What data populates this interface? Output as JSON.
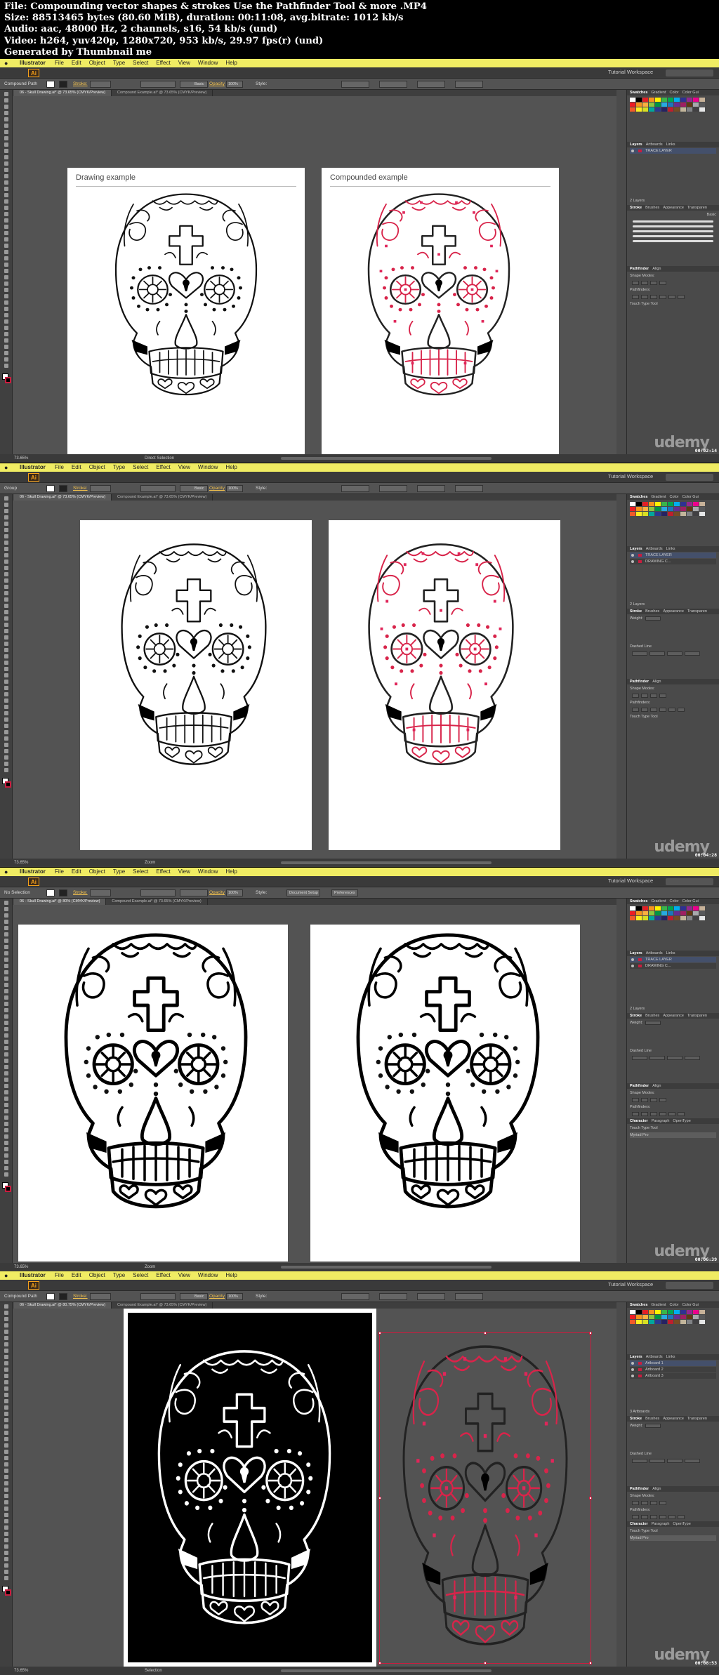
{
  "header": {
    "file_line": "File: Compounding vector shapes & strokes  Use the Pathfinder Tool & more .MP4",
    "size_line": "Size: 88513465 bytes (80.60 MiB), duration: 00:11:08, avg.bitrate: 1012 kb/s",
    "audio_line": "Audio: aac, 48000 Hz, 2 channels, s16, 54 kb/s (und)",
    "video_line": "Video: h264, yuv420p, 1280x720, 953 kb/s, 29.97 fps(r) (und)",
    "generated_line": "Generated by Thumbnail me"
  },
  "menubar": {
    "app_name": "Illustrator",
    "items": [
      "File",
      "Edit",
      "Object",
      "Type",
      "Select",
      "Effect",
      "View",
      "Window",
      "Help"
    ]
  },
  "appbar": {
    "logo": "Ai",
    "workspace": "Tutorial Workspace"
  },
  "panels": {
    "top_tabs": [
      "Swatches",
      "Gradient",
      "Color",
      "Color Gui"
    ],
    "layers_tabs": [
      "Layers",
      "Artboards",
      "Links"
    ],
    "stroke_tabs": [
      "Stroke",
      "Brushes",
      "Appearance",
      "Transparen"
    ],
    "stroke_weight_label": "Weight:",
    "dashed_line_label": "Dashed Line",
    "pathfinder_tabs": [
      "Pathfinder",
      "Align"
    ],
    "shape_modes_label": "Shape Modes:",
    "pathfinders_label": "Pathfinders:",
    "character_tabs": [
      "Character",
      "Paragraph",
      "OpenType"
    ],
    "touch_type_label": "Touch Type Tool",
    "font_name": "Myriad Pro",
    "brushes_basic": "Basic"
  },
  "watermark": "udemy",
  "frames": [
    {
      "selection_type": "Compound Path",
      "stroke_label": "Stroke:",
      "opacity_label": "Opacity",
      "style_label": "Style:",
      "brush_label": "Basic",
      "opacity_value": "100%",
      "tabs": [
        "06 - Skull Drawing.ai* @ 73.65% (CMYK/Preview)",
        "Compound Example.ai* @ 73.65% (CMYK/Preview)"
      ],
      "artboards": [
        "Drawing example",
        "Compounded example"
      ],
      "layers": [
        "TRACE LAYER"
      ],
      "layers_count": "2 Layers",
      "zoom": "73.65%",
      "status": "Direct Selection",
      "timestamp": "00:02:14"
    },
    {
      "selection_type": "Group",
      "stroke_label": "Stroke:",
      "opacity_label": "Opacity",
      "style_label": "Style:",
      "brush_label": "Basic",
      "opacity_value": "100%",
      "tabs": [
        "06 - Skull Drawing.ai* @ 73.65% (CMYK/Preview)",
        "Compound Example.ai* @ 73.65% (CMYK/Preview)"
      ],
      "artboards": [
        "",
        ""
      ],
      "layers": [
        "TRACE LAYER",
        "DRAWING C..."
      ],
      "layers_count": "2 Layers",
      "zoom": "73.65%",
      "status": "Zoom",
      "timestamp": "00:04:28"
    },
    {
      "selection_type": "No Selection",
      "stroke_label": "Stroke:",
      "opacity_label": "Opacity",
      "style_label": "Style:",
      "brush_label": "",
      "opacity_value": "100%",
      "document_setup": "Document Setup",
      "preferences": "Preferences",
      "tabs": [
        "06 - Skull Drawing.ai* @ 80% (CMYK/Preview)",
        "Compound Example.ai* @ 73.65% (CMYK/Preview)"
      ],
      "artboards": [
        "",
        ""
      ],
      "layers": [
        "TRACE LAYER",
        "DRAWING C..."
      ],
      "layers_count": "2 Layers",
      "zoom": "73.65%",
      "status": "Zoom",
      "timestamp": "00:06:39"
    },
    {
      "selection_type": "Compound Path",
      "stroke_label": "Stroke:",
      "opacity_label": "Opacity",
      "style_label": "Style:",
      "brush_label": "Basic",
      "opacity_value": "100%",
      "tabs": [
        "06 - Skull Drawing.ai* @ 80.75% (CMYK/Preview)",
        "Compound Example.ai* @ 73.65% (CMYK/Preview)"
      ],
      "artboards": [
        "",
        ""
      ],
      "layers": [
        "Artboard 1",
        "Artboard 2",
        "Artboard 3"
      ],
      "layers_count": "3 Artboards",
      "zoom": "73.65%",
      "status": "Selection",
      "timestamp": "00:08:53"
    }
  ]
}
